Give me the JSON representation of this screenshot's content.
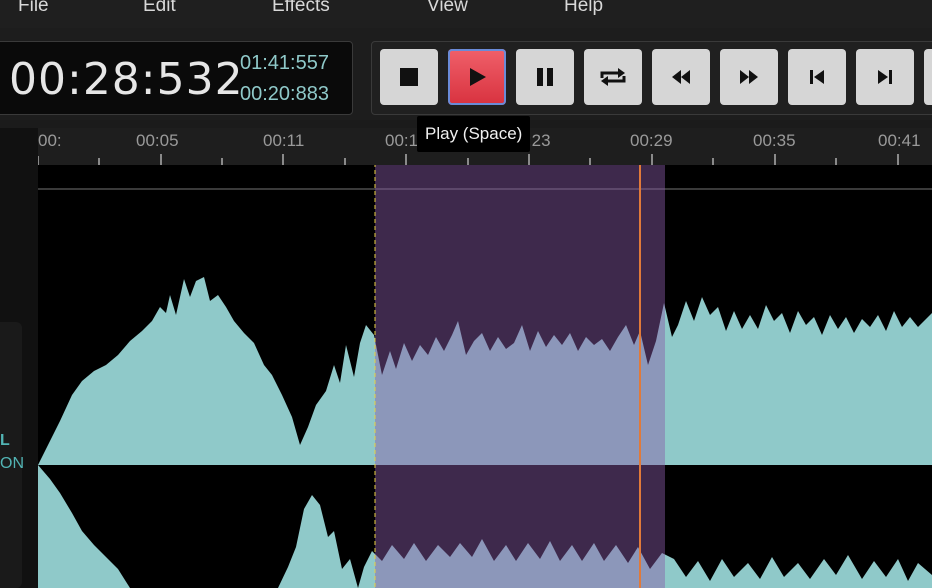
{
  "menu": [
    "File",
    "Edit",
    "Effects",
    "View",
    "Help"
  ],
  "time": {
    "current": "00:28:532",
    "total": "01:41:557",
    "selection": "00:20:883"
  },
  "transport": [
    {
      "name": "stop-button",
      "icon": "stop-icon"
    },
    {
      "name": "play-button",
      "icon": "play-icon",
      "active": true
    },
    {
      "name": "pause-button",
      "icon": "pause-icon"
    },
    {
      "name": "loop-button",
      "icon": "loop-icon"
    },
    {
      "name": "rewind-button",
      "icon": "rewind-icon"
    },
    {
      "name": "fast-forward-button",
      "icon": "fast-forward-icon"
    },
    {
      "name": "skip-start-button",
      "icon": "skip-start-icon"
    },
    {
      "name": "skip-end-button",
      "icon": "skip-end-icon"
    }
  ],
  "tooltip": "Play (Space)",
  "ruler": [
    "00:",
    "00:05",
    "00:11",
    "00:17",
    "00:23",
    "00:29",
    "00:35",
    "00:41"
  ],
  "track": {
    "label1": "L",
    "label2": "ON"
  },
  "colors": {
    "waveform": "#8fc9c9",
    "selection": "#8a5aa8",
    "cursor": "#e07a3a",
    "active_button": "#e8454f"
  }
}
